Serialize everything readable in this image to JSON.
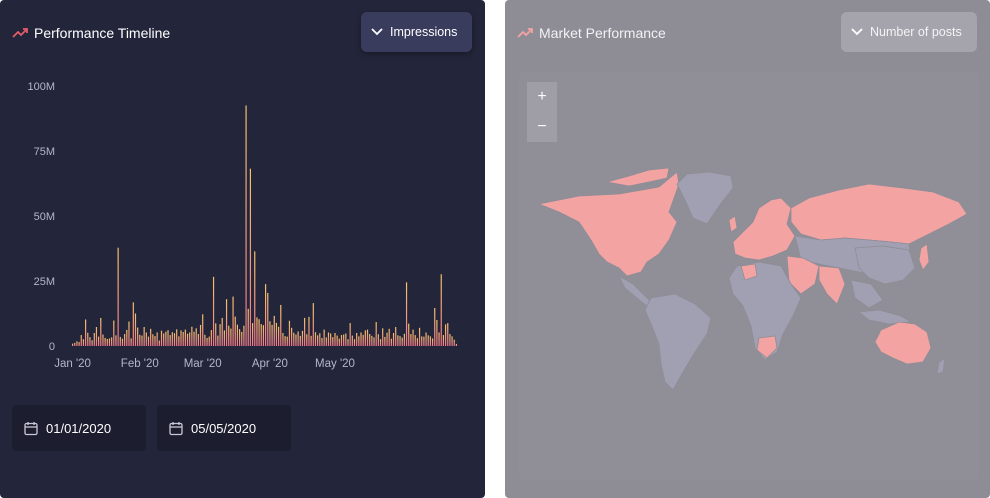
{
  "left_panel": {
    "title": "Performance Timeline",
    "metric_dropdown": {
      "selected": "Impressions"
    },
    "start_date": "01/01/2020",
    "end_date": "05/05/2020"
  },
  "right_panel": {
    "title": "Market Performance",
    "metric_dropdown": {
      "selected": "Number of posts"
    },
    "zoom_in_label": "+",
    "zoom_out_label": "−",
    "highlight_color": "#f4a3a3",
    "base_land_color": "#a19fb2"
  },
  "colors": {
    "accent": "#e85c6a",
    "bar_top": "#f5c26b",
    "bar_bottom": "#f0748a"
  },
  "icons": [
    "trend-up-icon",
    "chevron-down-icon",
    "calendar-icon",
    "plus-icon",
    "minus-icon"
  ],
  "chart_data": {
    "type": "bar",
    "title": "Performance Timeline",
    "x_ticks": [
      "Jan '20",
      "Feb '20",
      "Mar '20",
      "Apr '20",
      "May '20"
    ],
    "y_ticks": [
      "0",
      "25M",
      "50M",
      "75M",
      "100M"
    ],
    "ylim": [
      0,
      100
    ],
    "y_unit": "M",
    "x_start": "2020-01-01",
    "values": [
      0.9,
      1.2,
      1.8,
      1.5,
      4.2,
      2.6,
      10.2,
      5.1,
      3.4,
      2.2,
      5.0,
      7.3,
      3.6,
      10.8,
      4.4,
      3.1,
      2.7,
      2.9,
      3.3,
      9.8,
      4.1,
      37.8,
      3.5,
      2.8,
      4.6,
      6.2,
      9.4,
      2.9,
      16.8,
      12.5,
      7.1,
      4.3,
      4.0,
      7.3,
      5.2,
      3.6,
      6.6,
      4.5,
      3.8,
      5.2,
      2.1,
      5.9,
      4.8,
      5.5,
      6.1,
      4.2,
      5.3,
      4.9,
      6.4,
      3.7,
      6.0,
      5.4,
      6.3,
      4.7,
      5.2,
      7.4,
      5.5,
      6.8,
      4.6,
      8.1,
      12.2,
      4.3,
      3.1,
      3.6,
      6.1,
      26.6,
      8.7,
      4.0,
      8.4,
      10.8,
      6.0,
      18.0,
      7.8,
      6.7,
      19.0,
      11.3,
      8.2,
      6.5,
      5.4,
      7.8,
      92.5,
      14.3,
      68.2,
      8.8,
      36.4,
      11.0,
      10.3,
      8.4,
      8.0,
      23.8,
      20.4,
      9.5,
      8.1,
      11.6,
      8.9,
      7.4,
      15.8,
      5.0,
      3.8,
      3.6,
      9.7,
      7.0,
      5.1,
      4.4,
      5.6,
      3.9,
      5.8,
      10.8,
      4.5,
      11.2,
      3.9,
      16.5,
      5.3,
      4.1,
      4.9,
      3.1,
      6.3,
      3.3,
      5.2,
      4.8,
      3.4,
      5.0,
      4.0,
      2.8,
      4.2,
      4.4,
      4.8,
      2.6,
      8.8,
      4.0,
      2.6,
      5.0,
      3.7,
      5.2,
      4.3,
      6.0,
      6.3,
      4.6,
      3.9,
      3.3,
      9.2,
      4.5,
      2.6,
      6.8,
      3.5,
      5.1,
      6.6,
      2.8,
      5.0,
      7.3,
      4.1,
      3.8,
      3.2,
      4.7,
      24.5,
      8.6,
      4.6,
      6.3,
      4.2,
      3.0,
      7.0,
      3.7,
      3.6,
      5.2,
      4.1,
      3.7,
      2.9,
      14.6,
      10.0,
      5.2,
      27.6,
      4.2,
      8.3,
      8.8,
      4.6,
      3.7,
      2.4,
      0.8
    ]
  }
}
